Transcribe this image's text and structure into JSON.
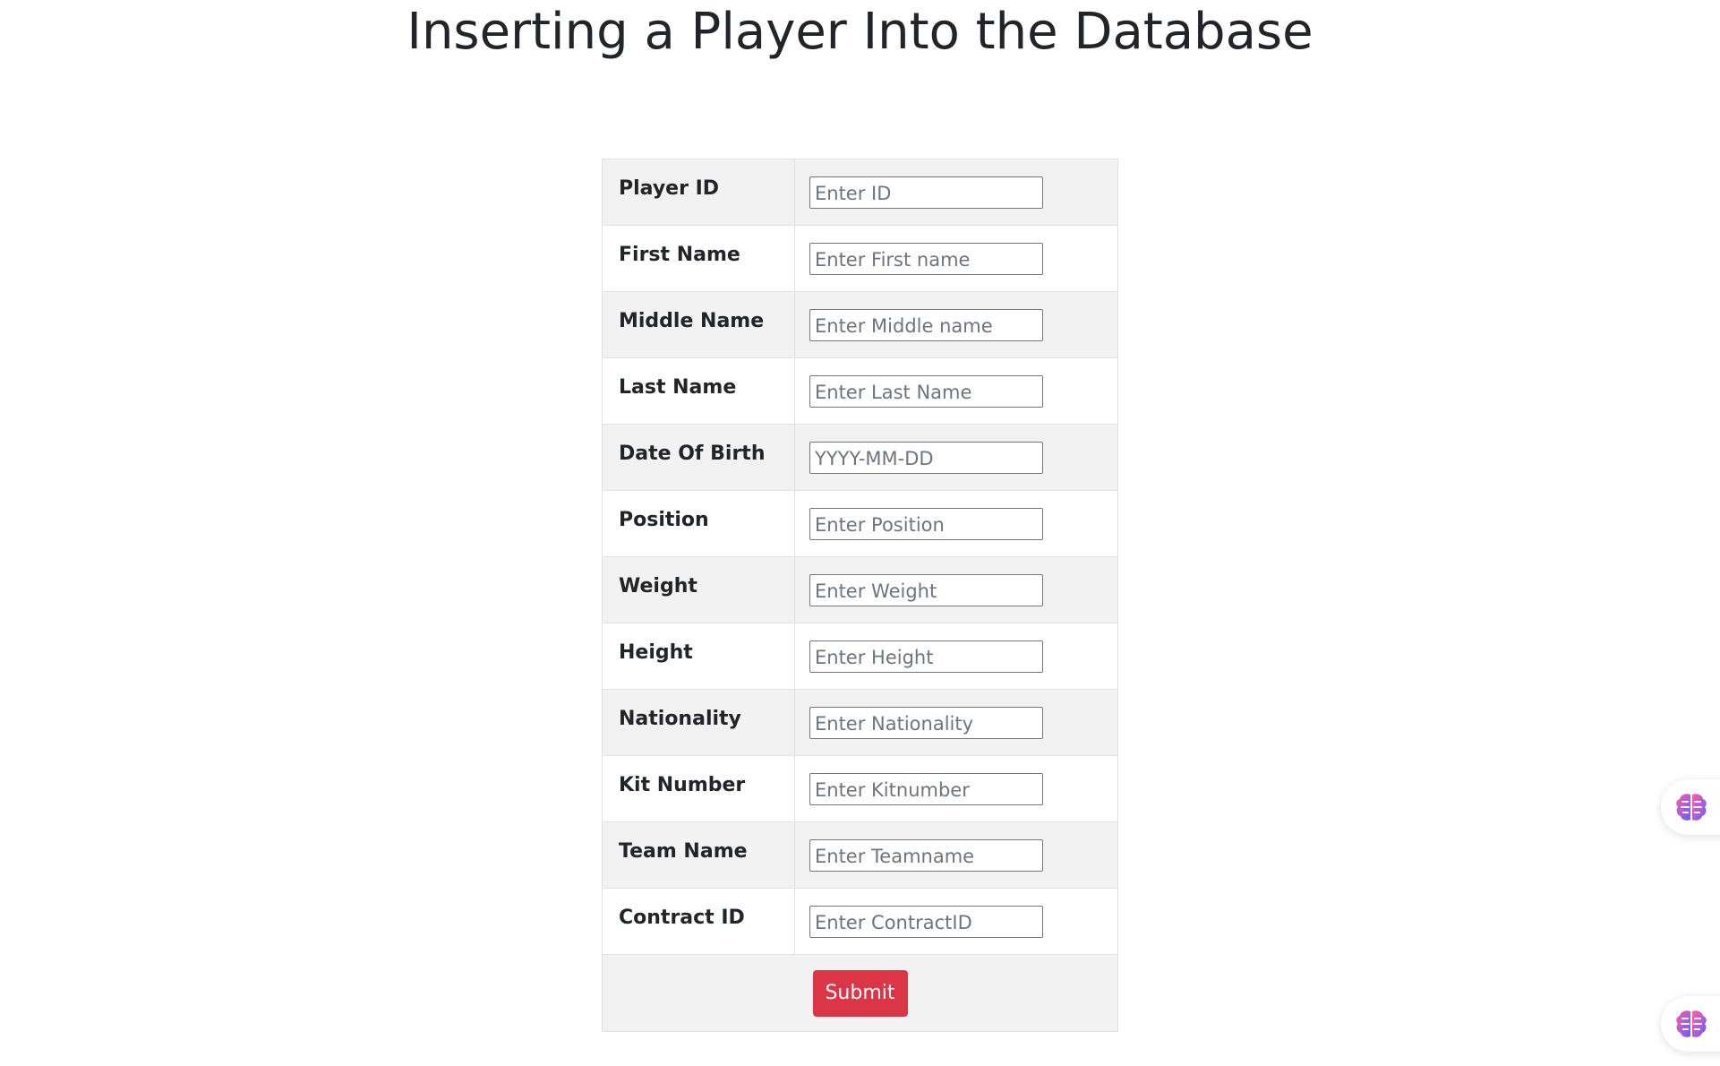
{
  "page": {
    "title": "Inserting a Player Into the Database"
  },
  "form": {
    "fields": [
      {
        "label": "Player ID",
        "placeholder": "Enter ID"
      },
      {
        "label": "First Name",
        "placeholder": "Enter First name"
      },
      {
        "label": "Middle Name",
        "placeholder": "Enter Middle name"
      },
      {
        "label": "Last Name",
        "placeholder": "Enter Last Name"
      },
      {
        "label": "Date Of Birth",
        "placeholder": "YYYY-MM-DD"
      },
      {
        "label": "Position",
        "placeholder": "Enter Position"
      },
      {
        "label": "Weight",
        "placeholder": "Enter Weight"
      },
      {
        "label": "Height",
        "placeholder": "Enter Height"
      },
      {
        "label": "Nationality",
        "placeholder": "Enter Nationality"
      },
      {
        "label": "Kit Number",
        "placeholder": "Enter Kitnumber"
      },
      {
        "label": "Team Name",
        "placeholder": "Enter Teamname"
      },
      {
        "label": "Contract ID",
        "placeholder": "Enter ContractID"
      }
    ],
    "submit_label": "Submit"
  },
  "colors": {
    "submit_button": "#dc3545",
    "row_striped": "#f2f2f2",
    "text": "#212529"
  },
  "widgets": {
    "icon": "brain-icon"
  }
}
